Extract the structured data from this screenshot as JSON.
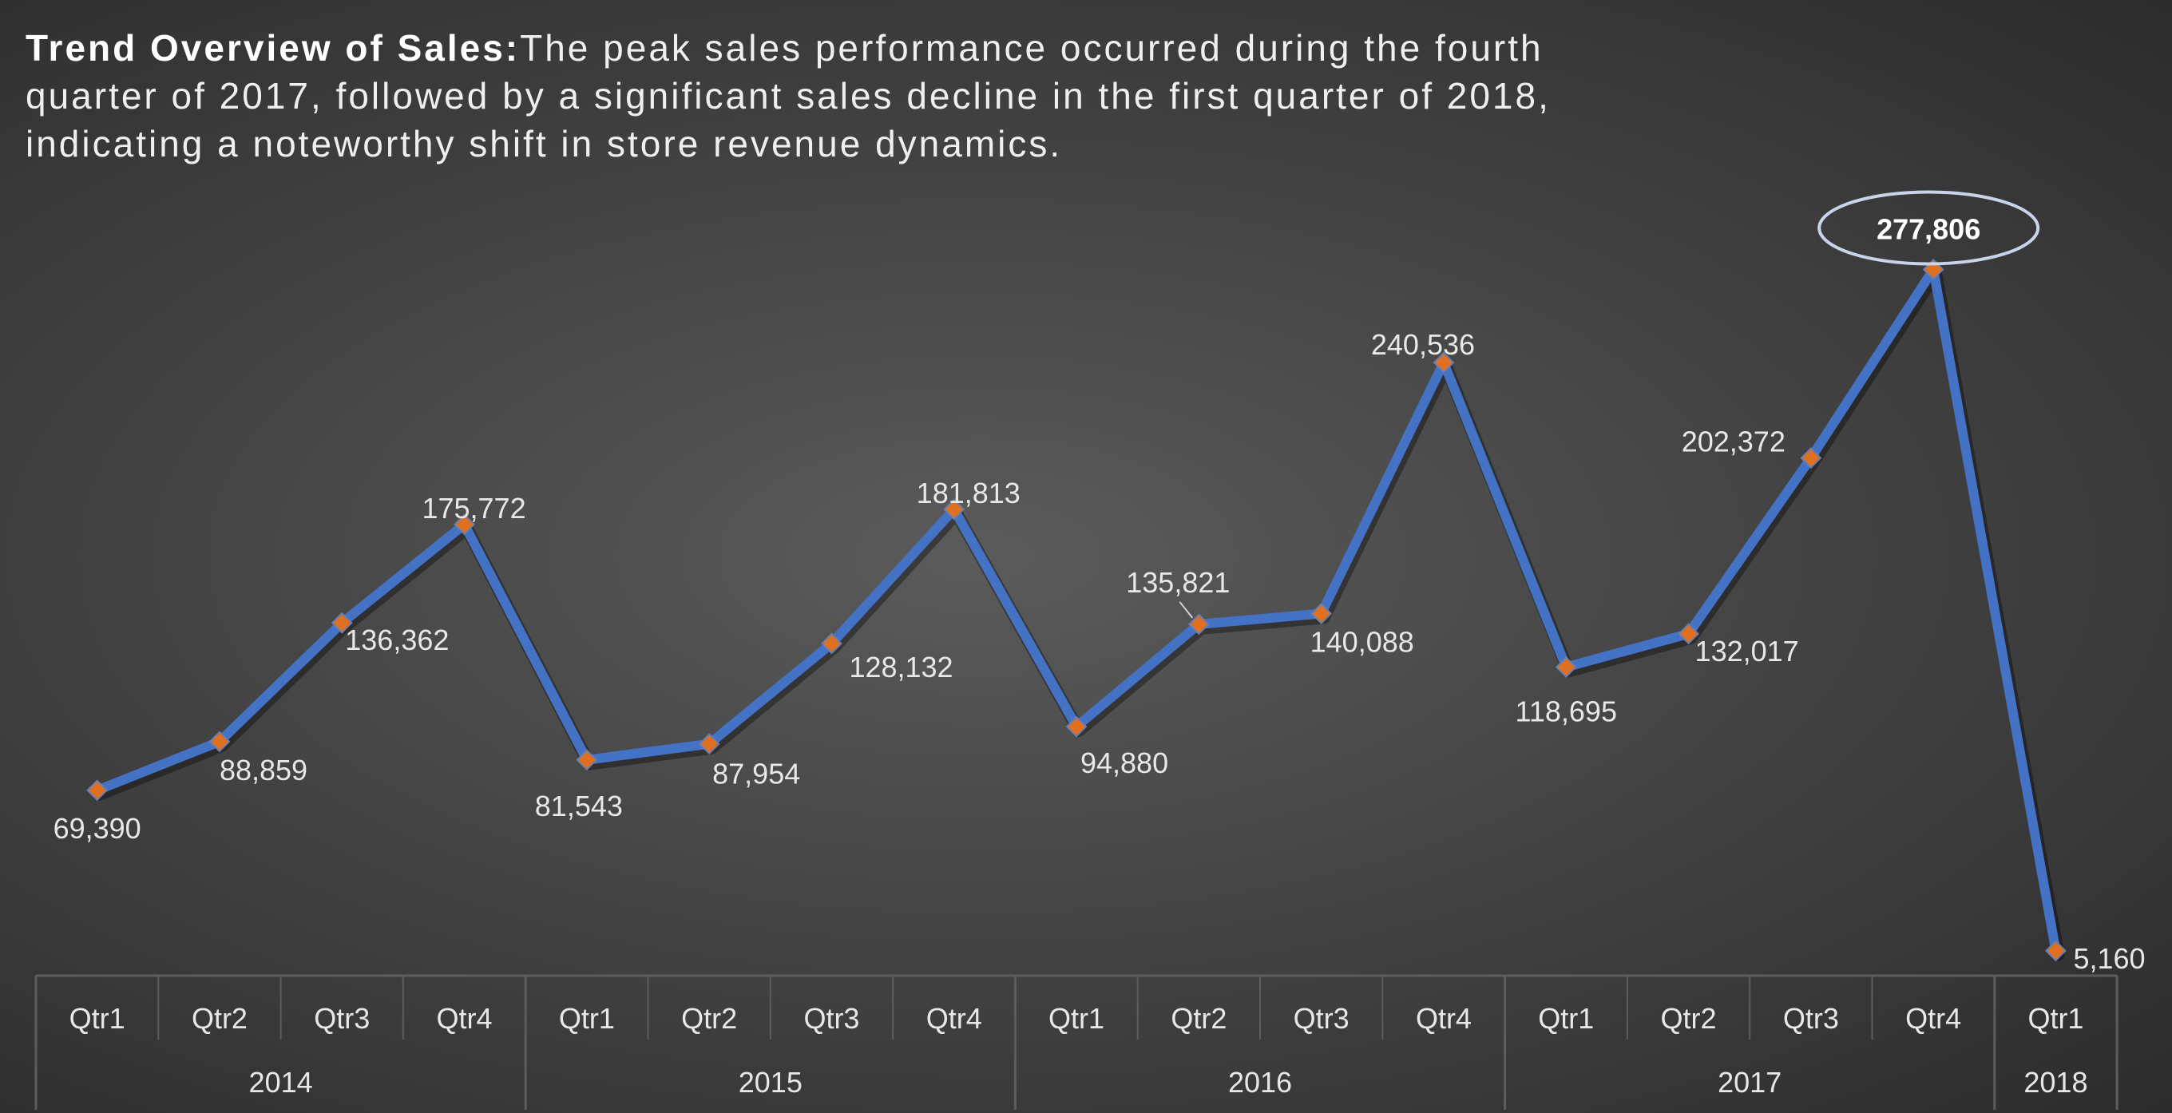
{
  "title": {
    "bold": "Trend Overview of Sales:",
    "text": "The peak sales performance occurred during the fourth quarter of 2017, followed by a significant sales decline in the first quarter of 2018, indicating a noteworthy shift in store revenue dynamics."
  },
  "chart_data": {
    "type": "line",
    "x": [
      "Qtr1",
      "Qtr2",
      "Qtr3",
      "Qtr4",
      "Qtr1",
      "Qtr2",
      "Qtr3",
      "Qtr4",
      "Qtr1",
      "Qtr2",
      "Qtr3",
      "Qtr4",
      "Qtr1",
      "Qtr2",
      "Qtr3",
      "Qtr4",
      "Qtr1"
    ],
    "years": [
      {
        "label": "2014",
        "quarters": 4
      },
      {
        "label": "2015",
        "quarters": 4
      },
      {
        "label": "2016",
        "quarters": 4
      },
      {
        "label": "2017",
        "quarters": 4
      },
      {
        "label": "2018",
        "quarters": 1
      }
    ],
    "series": [
      {
        "values": [
          69390,
          88859,
          136362,
          175772,
          81543,
          87954,
          128132,
          181813,
          94880,
          135821,
          140088,
          240536,
          118695,
          132017,
          202372,
          277806,
          5160
        ],
        "labels": [
          "69,390",
          "88,859",
          "136,362",
          "175,772",
          "81,543",
          "87,954",
          "128,132",
          "181,813",
          "94,880",
          "135,821",
          "140,088",
          "240,536",
          "118,695",
          "132,017",
          "202,372",
          "277,806",
          "5,160"
        ]
      }
    ],
    "highlight_index": 15,
    "ylim": [
      0,
      300000
    ],
    "grid": false,
    "colors": {
      "line": "#4472c4",
      "marker": "#e07020",
      "highlight_ring": "#c9d3ea",
      "axis": "#5d5d5d"
    }
  }
}
